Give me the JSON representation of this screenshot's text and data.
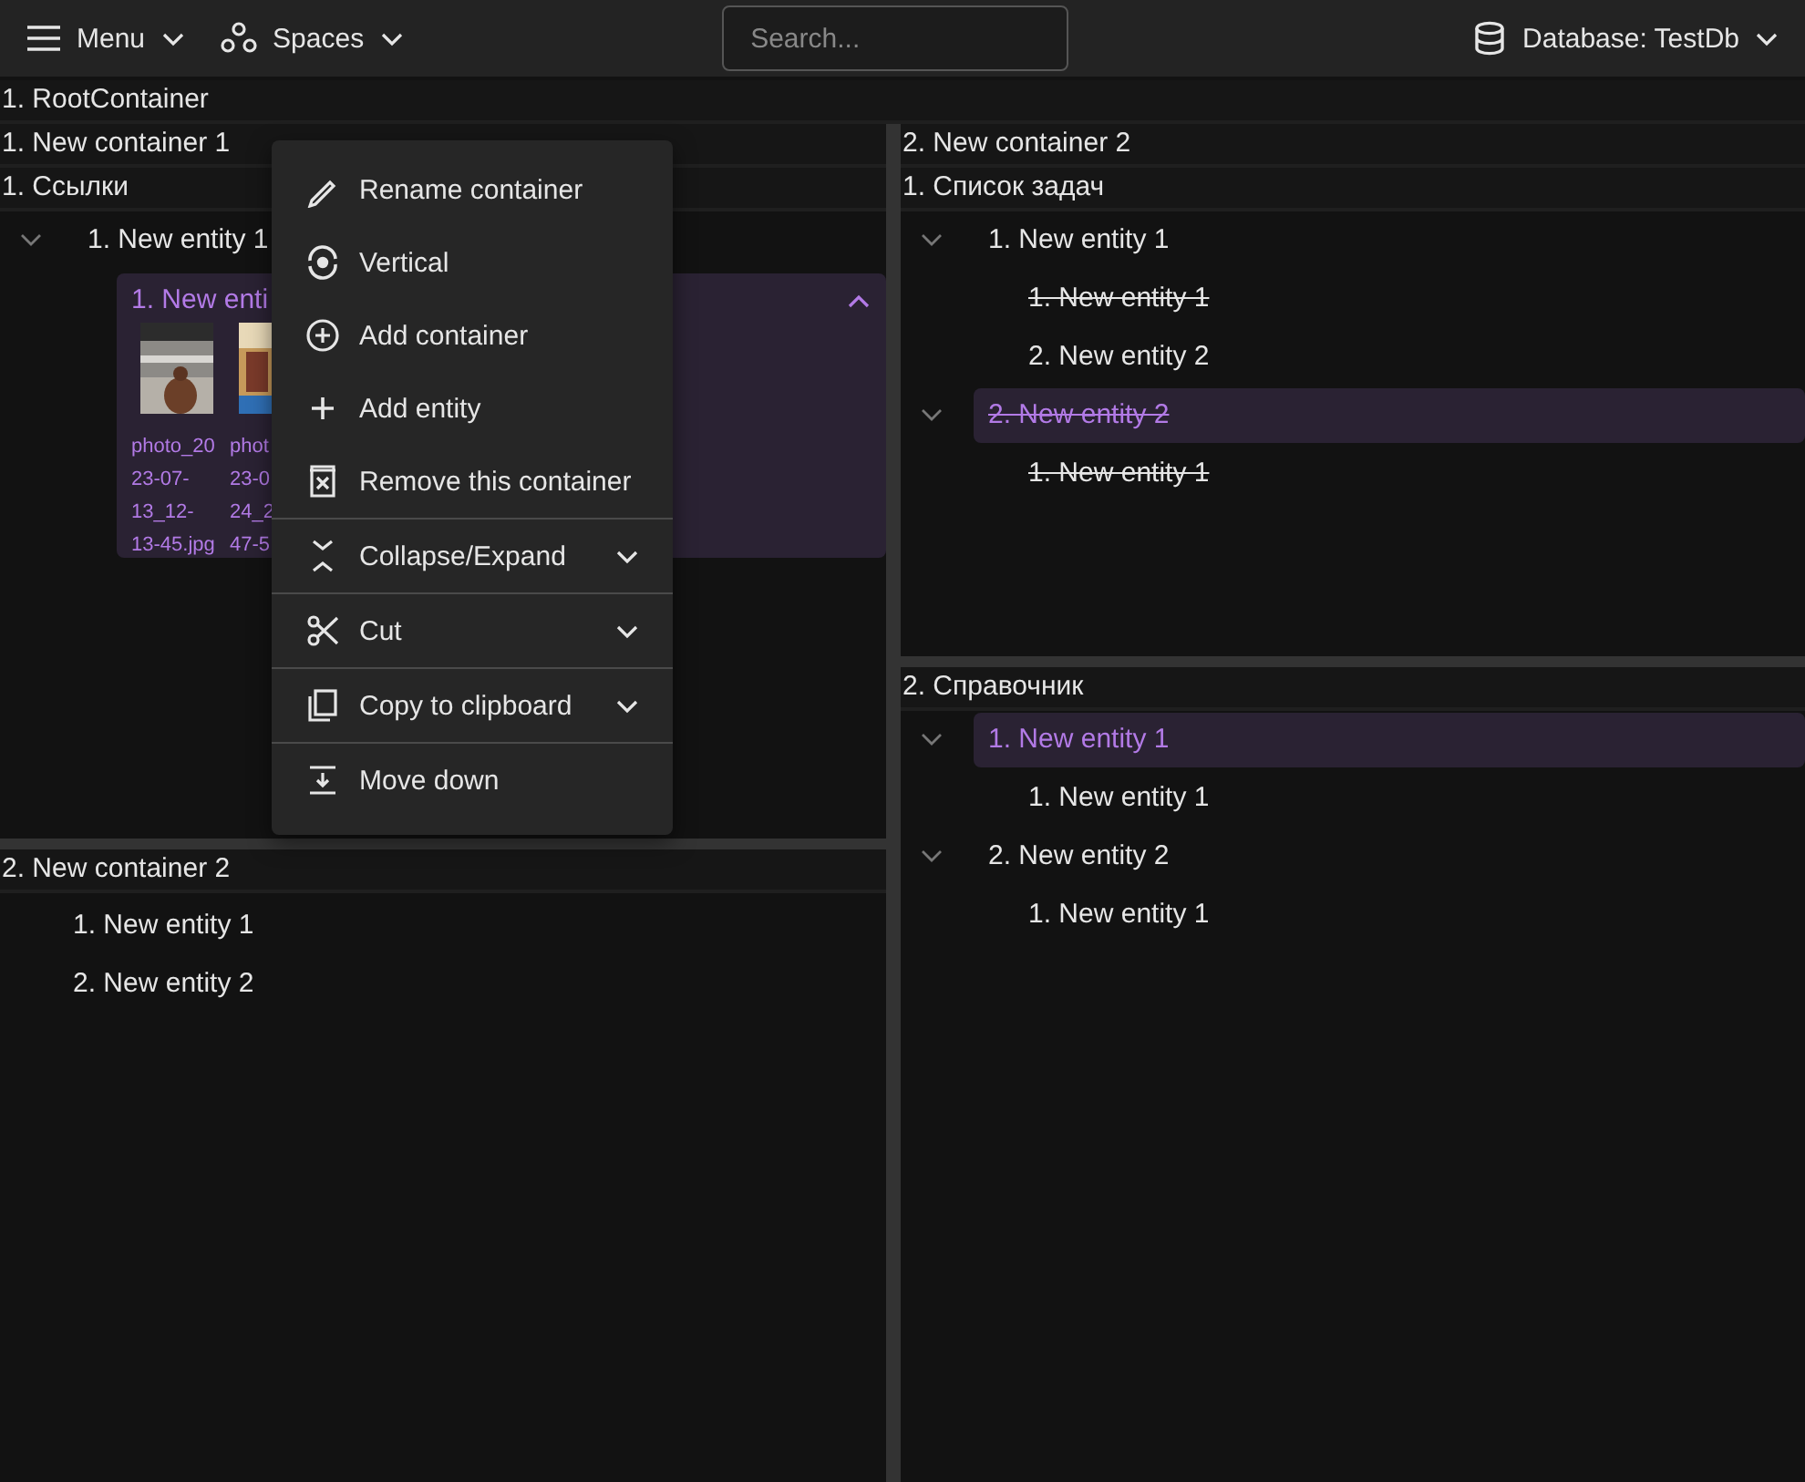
{
  "toolbar": {
    "menu": "Menu",
    "spaces": "Spaces",
    "search": {
      "placeholder": "Search..."
    },
    "database": "Database: TestDb"
  },
  "root": {
    "title": "1. RootContainer"
  },
  "left": {
    "top": {
      "title": "1. New container 1",
      "section": "1. Ссылки",
      "tree": [
        {
          "label": "1. New entity 1",
          "expanded": true,
          "card": {
            "title": "1. New enti",
            "selected": true,
            "files": [
              {
                "lines": [
                  "photo_20",
                  "23-07-",
                  "13_12-",
                  "13-45.jpg"
                ]
              },
              {
                "lines": [
                  "phot",
                  "23-0",
                  "24_2",
                  "47-5"
                ]
              }
            ]
          }
        }
      ]
    },
    "bottom": {
      "title": "2. New container 2",
      "items": [
        {
          "label": "1. New entity 1"
        },
        {
          "label": "2. New entity 2"
        }
      ]
    }
  },
  "right": {
    "title": "2. New container 2",
    "sections": [
      {
        "title": "1. Список задач",
        "tree": [
          {
            "label": "1. New entity 1",
            "done": false,
            "selected": false,
            "expanded": true,
            "children": [
              {
                "label": "1. New entity 1",
                "done": true
              },
              {
                "label": "2. New entity 2",
                "done": false
              }
            ]
          },
          {
            "label": "2. New entity 2",
            "done": true,
            "selected": true,
            "expanded": true,
            "children": [
              {
                "label": "1. New entity 1",
                "done": true
              }
            ]
          }
        ]
      },
      {
        "title": "2. Справочник",
        "tree": [
          {
            "label": "1. New entity 1",
            "done": false,
            "selected": true,
            "expanded": true,
            "children": [
              {
                "label": "1. New entity 1",
                "done": false
              }
            ]
          },
          {
            "label": "2. New entity 2",
            "done": false,
            "selected": false,
            "expanded": true,
            "children": [
              {
                "label": "1. New entity 1",
                "done": false
              }
            ]
          }
        ]
      }
    ]
  },
  "context_menu": [
    {
      "label": "Rename container",
      "kind": "action",
      "divider_before": false
    },
    {
      "label": "Vertical",
      "kind": "action",
      "divider_before": false
    },
    {
      "label": "Add container",
      "kind": "action",
      "divider_before": false
    },
    {
      "label": "Add entity",
      "kind": "action",
      "divider_before": false
    },
    {
      "label": "Remove this container",
      "kind": "action",
      "divider_before": false
    },
    {
      "label": "Collapse/Expand",
      "kind": "submenu",
      "divider_before": true
    },
    {
      "label": "Cut",
      "kind": "submenu",
      "divider_before": true
    },
    {
      "label": "Copy to clipboard",
      "kind": "submenu",
      "divider_before": true
    },
    {
      "label": "Move down",
      "kind": "action",
      "divider_before": true
    }
  ]
}
